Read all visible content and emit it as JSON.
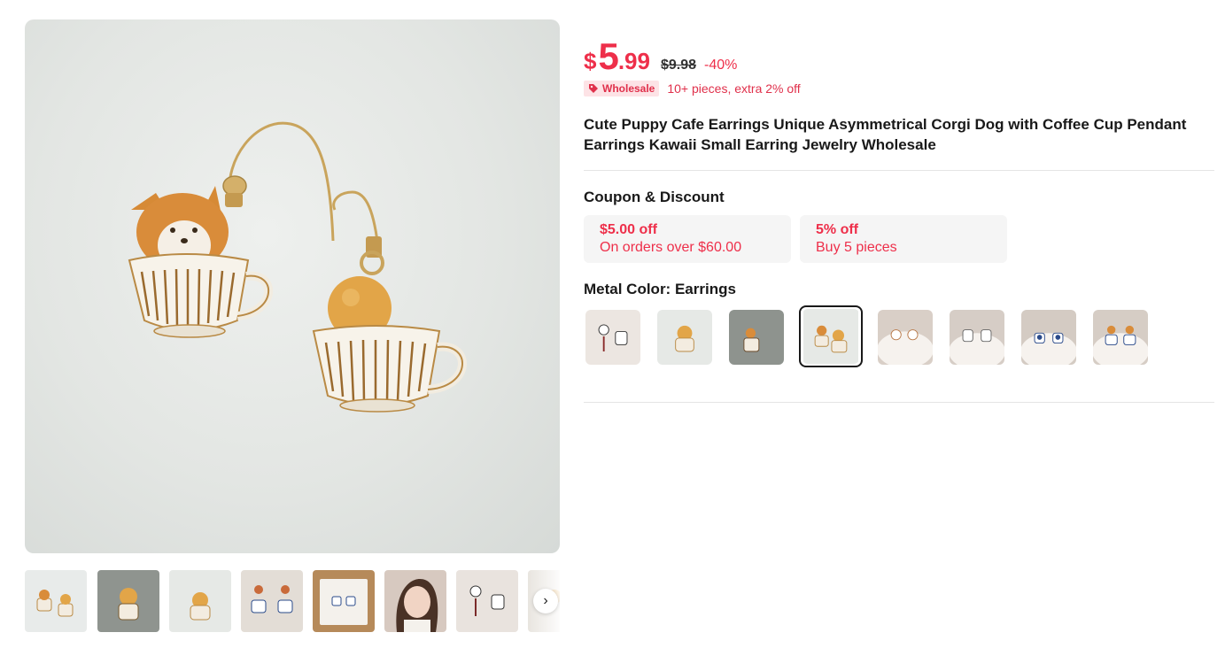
{
  "gallery": {
    "main_image_alt": "",
    "thumbnails": [
      {
        "name": "thumb-1"
      },
      {
        "name": "thumb-2"
      },
      {
        "name": "thumb-3"
      },
      {
        "name": "thumb-4"
      },
      {
        "name": "thumb-5"
      },
      {
        "name": "thumb-6"
      },
      {
        "name": "thumb-7"
      },
      {
        "name": "thumb-8"
      }
    ],
    "next_arrow": "›"
  },
  "price": {
    "currency": "$",
    "integer": "5",
    "decimal": ".99",
    "original": "$9.98",
    "discount": "-40%"
  },
  "wholesale": {
    "badge": "Wholesale",
    "text": "10+ pieces, extra 2% off"
  },
  "product": {
    "title": "Cute Puppy Cafe Earrings Unique Asymmetrical Corgi Dog with Coffee Cup Pendant Earrings Kawaii Small Earring Jewelry Wholesale"
  },
  "coupon_section": {
    "label": "Coupon & Discount",
    "coupons": [
      {
        "title": "$5.00 off",
        "desc": "On orders over $60.00"
      },
      {
        "title": "5% off",
        "desc": "Buy 5 pieces"
      }
    ]
  },
  "metal_color": {
    "label": "Metal Color: ",
    "value": "Earrings",
    "selected_index": 3,
    "option_count": 8
  },
  "colors": {
    "accent": "#ee2f4a",
    "badge_bg": "#fde3e6",
    "coupon_bg": "#f5f5f5",
    "selected_border": "#191919"
  }
}
